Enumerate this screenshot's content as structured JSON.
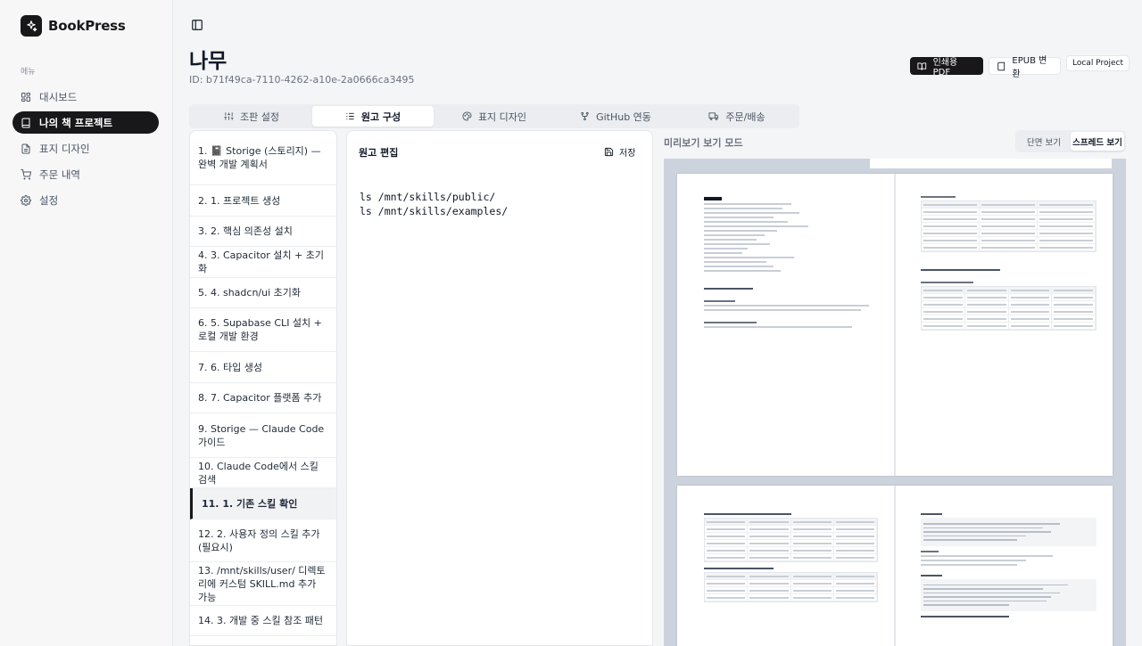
{
  "app": {
    "name": "BookPress"
  },
  "sidebar": {
    "menu_label": "메뉴",
    "items": [
      {
        "label": "대시보드",
        "icon": "dashboard-icon"
      },
      {
        "label": "나의 책 프로젝트",
        "icon": "book-icon",
        "active": true
      },
      {
        "label": "표지 디자인",
        "icon": "file-icon"
      },
      {
        "label": "주문 내역",
        "icon": "cart-icon"
      },
      {
        "label": "설정",
        "icon": "gear-icon"
      }
    ]
  },
  "header": {
    "title": "나무",
    "id_text": "ID: b71f49ca-7110-4262-a10e-2a0666ca3495",
    "pdf_button": "인쇄용 PDF",
    "epub_button": "EPUB 변환",
    "local_badge": "Local Project"
  },
  "tabs": [
    {
      "label": "조판 설정",
      "icon": "sliders-icon"
    },
    {
      "label": "원고 구성",
      "icon": "list-icon",
      "active": true
    },
    {
      "label": "표지 디자인",
      "icon": "palette-icon"
    },
    {
      "label": "GitHub 연동",
      "icon": "git-branch-icon"
    },
    {
      "label": "주문/배송",
      "icon": "truck-icon"
    }
  ],
  "chapters": [
    {
      "label": "1. 📓 Storige (스토리지) — 완벽 개발 계획서"
    },
    {
      "label": "2. 1. 프로젝트 생성"
    },
    {
      "label": "3. 2. 핵심 의존성 설치"
    },
    {
      "label": "4. 3. Capacitor 설치 + 초기화"
    },
    {
      "label": "5. 4. shadcn/ui 초기화"
    },
    {
      "label": "6. 5. Supabase CLI 설치 + 로컬 개발 환경"
    },
    {
      "label": "7. 6. 타입 생성"
    },
    {
      "label": "8. 7. Capacitor 플랫폼 추가"
    },
    {
      "label": "9. Storige — Claude Code 가이드"
    },
    {
      "label": "10. Claude Code에서 스킬 검색"
    },
    {
      "label": "11. 1. 기존 스킬 확인",
      "active": true
    },
    {
      "label": "12. 2. 사용자 정의 스킬 추가 (필요시)"
    },
    {
      "label": "13. /mnt/skills/user/ 디렉토리에 커스텀 SKILL.md 추가 가능"
    },
    {
      "label": "14. 3. 개발 중 스킬 참조 패턴"
    }
  ],
  "editor": {
    "title": "원고 편집",
    "save_label": "저장",
    "content": "ls /mnt/skills/public/\nls /mnt/skills/examples/"
  },
  "preview": {
    "label": "미리보기 보기 모드",
    "single_view": "단면 보기",
    "spread_view": "스프레드 보기"
  }
}
